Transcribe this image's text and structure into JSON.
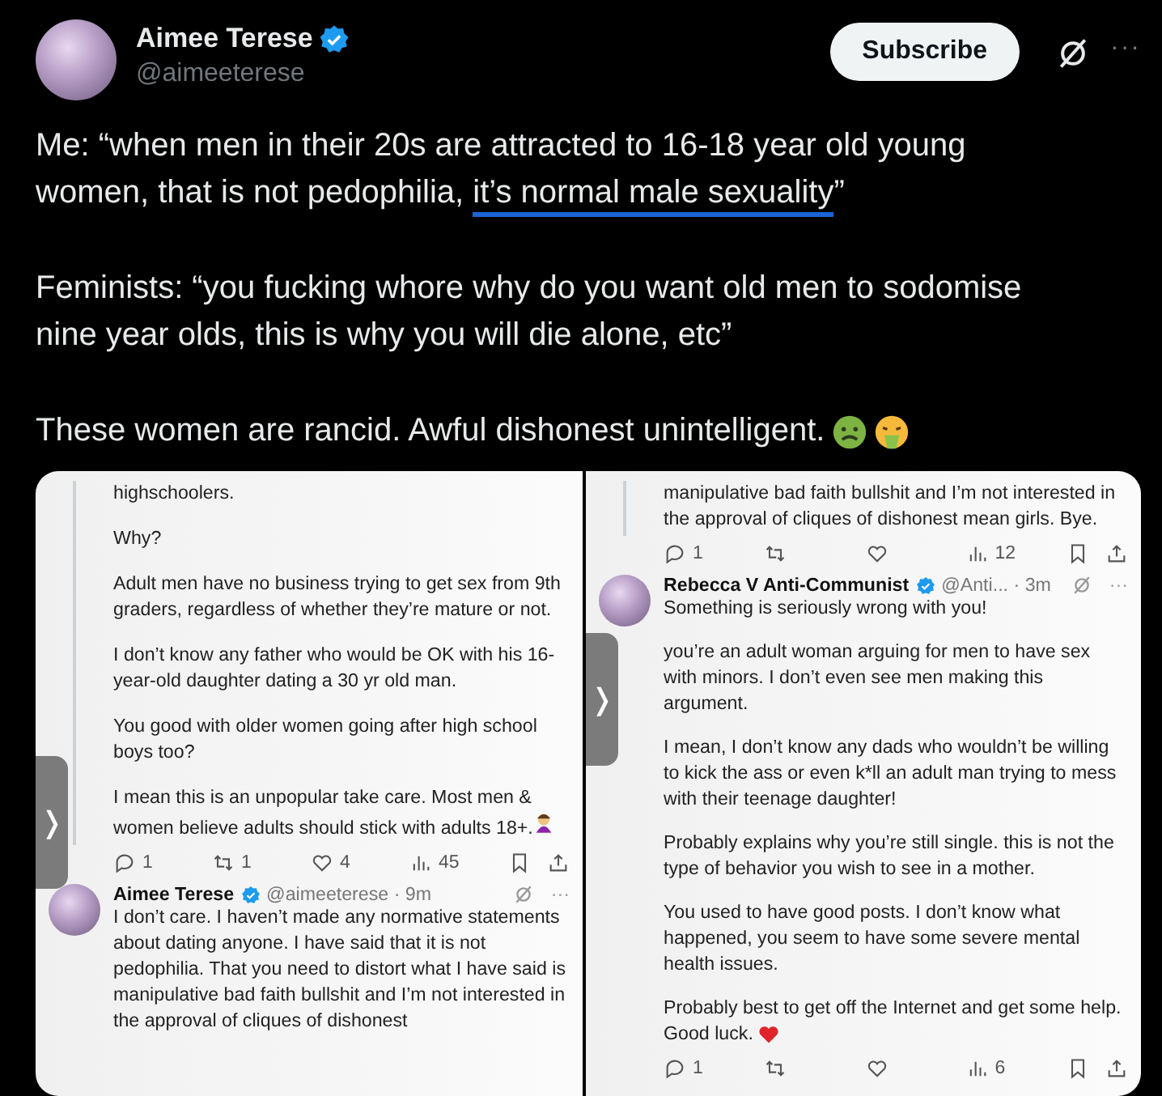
{
  "author": {
    "name": "Aimee Terese",
    "handle": "@aimeeterese",
    "verified": true
  },
  "actions": {
    "subscribe": "Subscribe",
    "more": "···"
  },
  "post": [
    {
      "parts": [
        {
          "text": "Me: “when men in their 20s are attracted to 16-18 year old young women, that is not pedophilia, "
        },
        {
          "text": "it’s normal male sexuality",
          "underlined": true
        },
        {
          "text": "”"
        }
      ]
    },
    {
      "parts": [
        {
          "text": "Feminists: “you fucking whore why do you want old men to sodomise nine year olds, this is why you will die alone, etc”"
        }
      ]
    },
    {
      "parts": [
        {
          "text": "These women are rancid. Awful dishonest unintelligent."
        }
      ],
      "emojis": [
        {
          "kind": "nauseated"
        },
        {
          "kind": "vomiting"
        }
      ]
    }
  ],
  "screenshots": [
    {
      "tab": "❭",
      "blocks": [
        {
          "kind": "text",
          "paragraphs": [
            {
              "text": "highschoolers."
            },
            {
              "text": "Why?"
            },
            {
              "text": "Adult men have no business trying to get sex from 9th graders, regardless of whether they’re mature or not."
            },
            {
              "text": "I don’t know any father who would be OK with his 16-year-old daughter dating a 30 yr old man."
            },
            {
              "text": "You good with older women going after high school boys too?"
            },
            {
              "text": "I mean this is an unpopular take care. Most men & women believe adults should stick with adults 18+.",
              "emojis": [
                {
                  "kind": "woman"
                }
              ]
            }
          ]
        },
        {
          "kind": "actions",
          "items": [
            {
              "kind": "reply",
              "count": "1"
            },
            {
              "kind": "repost",
              "count": "1"
            },
            {
              "kind": "like",
              "count": "4"
            },
            {
              "kind": "views",
              "count": "45"
            },
            {
              "kind": "bookmark"
            },
            {
              "kind": "share"
            }
          ]
        },
        {
          "kind": "tweet",
          "name": "Aimee Terese",
          "verified": true,
          "meta": "@aimeeterese · 9m",
          "more": "···",
          "paragraphs": [
            {
              "text": "I don’t care. I haven’t made any normative statements about dating anyone. I have said that it is not pedophilia. That you need to distort what I have said is manipulative bad faith bullshit and I’m not interested in the approval of cliques of dishonest"
            }
          ]
        }
      ]
    },
    {
      "tab": "❭",
      "blocks": [
        {
          "kind": "text",
          "paragraphs": [
            {
              "text": "manipulative bad faith bullshit and I’m not interested in the approval of cliques of dishonest mean girls. Bye."
            }
          ]
        },
        {
          "kind": "actions",
          "items": [
            {
              "kind": "reply",
              "count": "1"
            },
            {
              "kind": "repost"
            },
            {
              "kind": "like"
            },
            {
              "kind": "views",
              "count": "12"
            },
            {
              "kind": "bookmark"
            },
            {
              "kind": "share"
            }
          ]
        },
        {
          "kind": "tweet",
          "name": "Rebecca V Anti-Communist",
          "verified": true,
          "meta": "@Anti... · 3m",
          "more": "···",
          "paragraphs": [
            {
              "text": "Something is seriously wrong with you!"
            },
            {
              "text": "you’re an adult woman arguing for men to have sex with minors. I don’t even see men making this argument."
            },
            {
              "text": "I mean, I don’t know any dads who wouldn’t be willing to kick the ass or even k*ll an adult man trying to mess with their teenage daughter!"
            },
            {
              "text": "Probably explains why you’re still single. this is not the type of behavior you wish to see in a mother."
            },
            {
              "text": "You used to have good posts. I don’t know what happened, you seem to have some severe mental health issues."
            },
            {
              "text": "Probably best to get off the Internet and get some help. Good luck.",
              "emojis": [
                {
                  "kind": "heart"
                }
              ]
            }
          ]
        },
        {
          "kind": "actions",
          "items": [
            {
              "kind": "reply",
              "count": "1"
            },
            {
              "kind": "repost"
            },
            {
              "kind": "like"
            },
            {
              "kind": "views",
              "count": "6"
            },
            {
              "kind": "bookmark"
            },
            {
              "kind": "share"
            }
          ]
        }
      ]
    }
  ]
}
